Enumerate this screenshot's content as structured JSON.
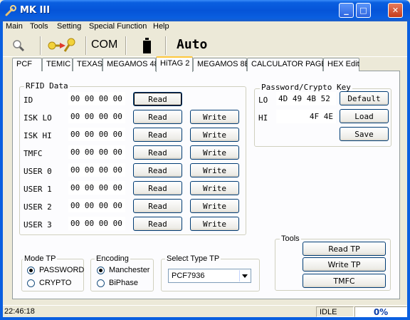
{
  "window": {
    "title": "MK III",
    "minimize": "_",
    "maximize": "□",
    "close": "✕"
  },
  "menu": [
    "Main",
    "Tools",
    "Setting",
    "Special Function",
    "Help"
  ],
  "toolbar": {
    "com_label": "COM",
    "auto_label": "Auto"
  },
  "tabs": [
    "PCF",
    "TEMIC",
    "TEXAS",
    "MEGAMOS 48",
    "HiTAG 2",
    "MEGAMOS 8E",
    "CALCULATOR PAGE",
    "HEX Edit"
  ],
  "active_tab": "HiTAG 2",
  "rfid": {
    "title": "RFID Data",
    "rows": [
      {
        "label": "ID",
        "value": "00 00 00 00",
        "read": "Read",
        "write": ""
      },
      {
        "label": "ISK LO",
        "value": "00 00 00 00",
        "read": "Read",
        "write": "Write"
      },
      {
        "label": "ISK HI",
        "value": "00 00 00 00",
        "read": "Read",
        "write": "Write"
      },
      {
        "label": "TMFC",
        "value": "00 00 00 00",
        "read": "Read",
        "write": "Write"
      },
      {
        "label": "USER 0",
        "value": "00 00 00 00",
        "read": "Read",
        "write": "Write"
      },
      {
        "label": "USER 1",
        "value": "00 00 00 00",
        "read": "Read",
        "write": "Write"
      },
      {
        "label": "USER 2",
        "value": "00 00 00 00",
        "read": "Read",
        "write": "Write"
      },
      {
        "label": "USER 3",
        "value": "00 00 00 00",
        "read": "Read",
        "write": "Write"
      }
    ]
  },
  "password": {
    "title": "Password/Crypto Key",
    "lo_label": "LO",
    "lo_value": "4D 49 4B 52",
    "hi_label": "HI",
    "hi_value": "4F 4E",
    "default_btn": "Default",
    "load_btn": "Load",
    "save_btn": "Save"
  },
  "tools": {
    "title": "Tools",
    "read_tp": "Read TP",
    "write_tp": "Write TP",
    "tmfc": "TMFC"
  },
  "mode_tp": {
    "title": "Mode TP",
    "options": [
      "PASSWORD",
      "CRYPTO"
    ],
    "selected": "PASSWORD"
  },
  "encoding": {
    "title": "Encoding",
    "options": [
      "Manchester",
      "BiPhase"
    ],
    "selected": "Manchester"
  },
  "select_type": {
    "title": "Select Type TP",
    "value": "PCF7936"
  },
  "status": {
    "time": "22:46:18",
    "state": "IDLE",
    "progress": "0%"
  },
  "colors": {
    "titlebar": "#0554D8",
    "tab_active_accent": "#FFC83C",
    "progress_text": "#0A3DA8"
  }
}
